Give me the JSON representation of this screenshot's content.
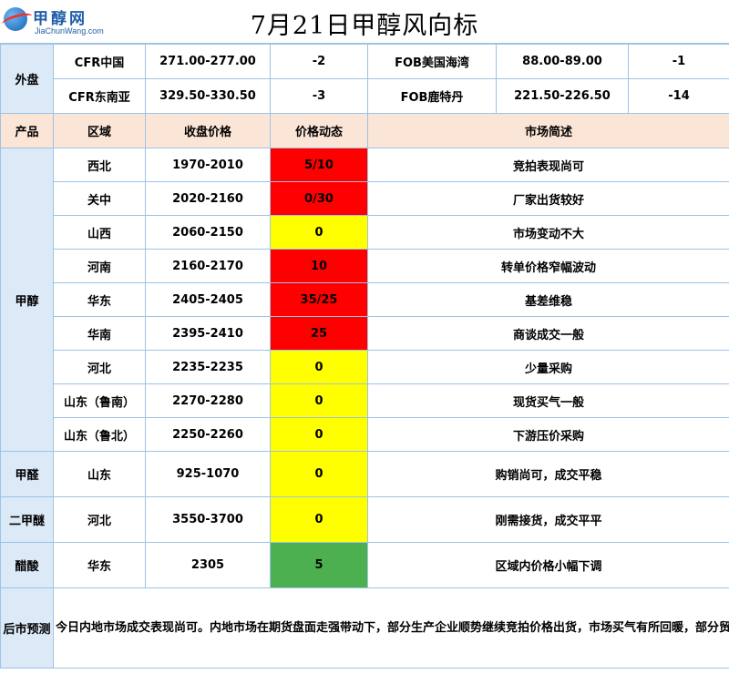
{
  "logo": {
    "cn": "甲醇网",
    "en": "JiaChunWang.com"
  },
  "title": "7月21日甲醇风向标",
  "colors": {
    "border": "#9dc3e6",
    "label_bg": "#dce9f7",
    "header_bg": "#fbe5d6",
    "up": "#ff0000",
    "flat": "#ffff00",
    "down": "#4cb050"
  },
  "external": {
    "label": "外盘",
    "rows": [
      {
        "left_name": "CFR中国",
        "left_price": "271.00-277.00",
        "left_change": "-2",
        "right_name": "FOB美国海湾",
        "right_price": "88.00-89.00",
        "right_change": "-1"
      },
      {
        "left_name": "CFR东南亚",
        "left_price": "329.50-330.50",
        "left_change": "-3",
        "right_name": "FOB鹿特丹",
        "right_price": "221.50-226.50",
        "right_change": "-14"
      }
    ]
  },
  "headers": {
    "product": "产品",
    "region": "区域",
    "close_price": "收盘价格",
    "dynamics": "价格动态",
    "summary": "市场简述"
  },
  "products": {
    "methanol": {
      "label": "甲醇",
      "rows": [
        {
          "region": "西北",
          "price": "1970-2010",
          "change": "5/10",
          "trend": "up",
          "summary": "竞拍表现尚可"
        },
        {
          "region": "关中",
          "price": "2020-2160",
          "change": "0/30",
          "trend": "up",
          "summary": "厂家出货较好"
        },
        {
          "region": "山西",
          "price": "2060-2150",
          "change": "0",
          "trend": "flat",
          "summary": "市场变动不大"
        },
        {
          "region": "河南",
          "price": "2160-2170",
          "change": "10",
          "trend": "up",
          "summary": "转单价格窄幅波动"
        },
        {
          "region": "华东",
          "price": "2405-2405",
          "change": "35/25",
          "trend": "up",
          "summary": "基差维稳"
        },
        {
          "region": "华南",
          "price": "2395-2410",
          "change": "25",
          "trend": "up",
          "summary": "商谈成交一般"
        },
        {
          "region": "河北",
          "price": "2235-2235",
          "change": "0",
          "trend": "flat",
          "summary": "少量采购"
        },
        {
          "region": "山东（鲁南）",
          "price": "2270-2280",
          "change": "0",
          "trend": "flat",
          "summary": "现货买气一般"
        },
        {
          "region": "山东（鲁北）",
          "price": "2250-2260",
          "change": "0",
          "trend": "flat",
          "summary": "下游压价采购"
        }
      ]
    },
    "formaldehyde": {
      "label": "甲醛",
      "region": "山东",
      "price": "925-1070",
      "change": "0",
      "trend": "flat",
      "summary": "购销尚可，成交平稳"
    },
    "dme": {
      "label": "二甲醚",
      "region": "河北",
      "price": "3550-3700",
      "change": "0",
      "trend": "flat",
      "summary": "刚需接货，成交平平"
    },
    "acetic": {
      "label": "醋酸",
      "region": "华东",
      "price": "2305",
      "change": "5",
      "trend": "down",
      "summary": "区域内价格小幅下调"
    }
  },
  "forecast": {
    "label": "后市预测",
    "text": "今日内地市场成交表现尚可。内地市场在期货盘面走强带动下，部分生产企业顺势继续竞拍价格出货，市场买气有所回暖，部分贸易商及下游积极补货，推动成交价格小幅上涨，成交表现尚可，贸易商转单价格变动幅度相对有限，传统下游需求仍显疲弱，下游跟进一般。预计短期甲醇市场走势区间震荡。"
  }
}
